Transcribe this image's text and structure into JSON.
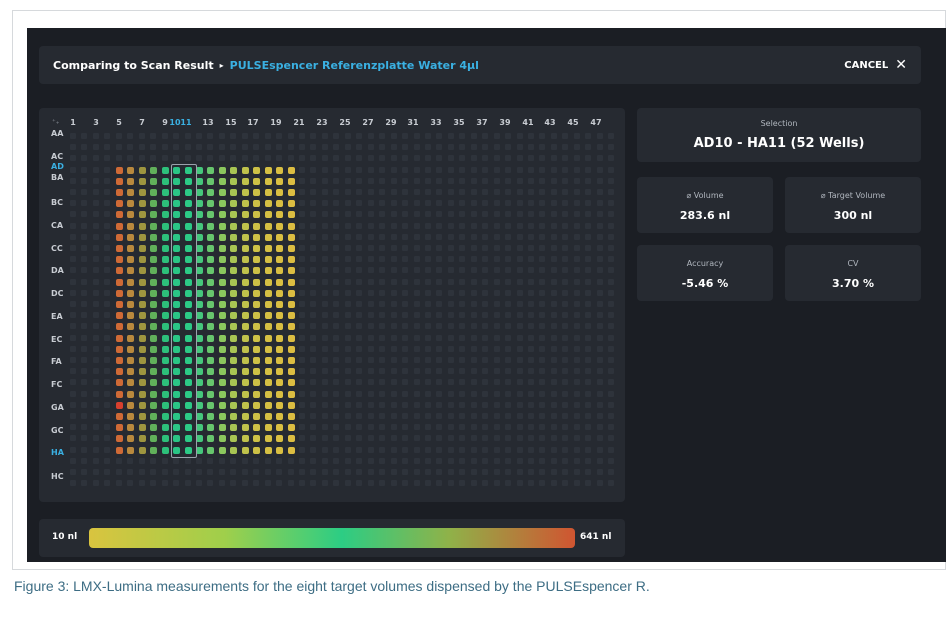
{
  "header": {
    "title": "Comparing to Scan Result",
    "arrow_icon": "▸",
    "scan_name": "PULSEspencer Referenzplatte Water 4µl",
    "cancel_label": "CANCEL",
    "close_icon": "✕"
  },
  "plate": {
    "corner_icon": "⁺₊",
    "column_labels": [
      "1",
      "3",
      "5",
      "7",
      "9",
      "10",
      "11",
      "13",
      "15",
      "17",
      "19",
      "21",
      "23",
      "25",
      "27",
      "29",
      "31",
      "33",
      "35",
      "37",
      "39",
      "41",
      "43",
      "45",
      "47"
    ],
    "highlighted_columns": [
      "10",
      "11"
    ],
    "row_labels": [
      "AA",
      "AC",
      "AD",
      "BA",
      "BC",
      "CA",
      "CC",
      "DA",
      "DC",
      "EA",
      "EC",
      "FA",
      "FC",
      "GA",
      "GC",
      "HA",
      "HC"
    ],
    "highlighted_rows": [
      "AD",
      "HA"
    ],
    "selection": {
      "rows": [
        "AD",
        "HA"
      ],
      "columns": [
        "10",
        "11"
      ]
    }
  },
  "legend": {
    "min_label": "10 nl",
    "max_label": "641 nl",
    "colors": [
      "#d9c43f",
      "#9fcf4b",
      "#2ccd84",
      "#8fb249",
      "#d05531"
    ]
  },
  "stats": {
    "selection_label": "Selection",
    "selection_value": "AD10 - HA11 (52 Wells)",
    "volume_label": "⌀ Volume",
    "volume_value": "283.6 nl",
    "target_label": "⌀ Target Volume",
    "target_value": "300 nl",
    "accuracy_label": "Accuracy",
    "accuracy_value": "-5.46 %",
    "cv_label": "CV",
    "cv_value": "3.70 %"
  },
  "caption": "Figure 3: LMX-Lumina measurements for the eight target volumes dispensed by the PULSEspencer R."
}
